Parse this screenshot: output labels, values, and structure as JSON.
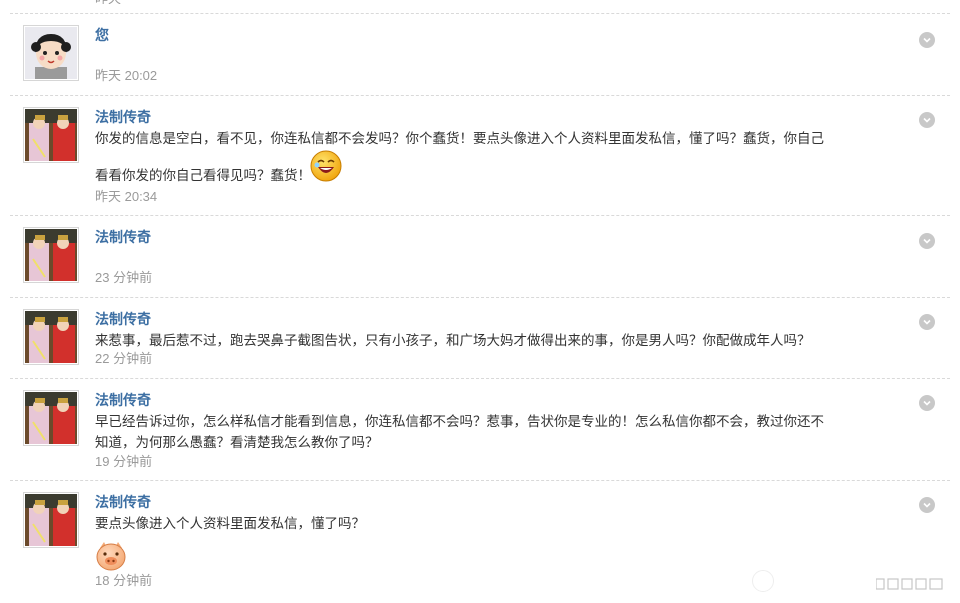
{
  "top_fragment": "昨天",
  "messages": [
    {
      "sender": "您",
      "text_lines": [],
      "time": "昨天 20:02",
      "avatar": "cartoon-girl-avatar"
    },
    {
      "sender": "法制传奇",
      "text_lines": [
        "你发的信息是空白，看不见，你连私信都不会发吗？你个蠢货！要点头像进入个人资料里面发私信，懂了吗？蠢货，你自己",
        "看看你发的你自己看得见吗？蠢货！"
      ],
      "emoji": "laughing-face-emoji",
      "time": "昨天 20:34",
      "avatar": "couple-photo-avatar"
    },
    {
      "sender": "法制传奇",
      "text_lines": [],
      "time": "23 分钟前",
      "avatar": "couple-photo-avatar"
    },
    {
      "sender": "法制传奇",
      "text_lines": [
        "来惹事，最后惹不过，跑去哭鼻子截图告状，只有小孩子，和广场大妈才做得出来的事，你是男人吗？你配做成年人吗？"
      ],
      "time": "22 分钟前",
      "avatar": "couple-photo-avatar"
    },
    {
      "sender": "法制传奇",
      "text_lines": [
        "早已经告诉过你，怎么样私信才能看到信息，你连私信都不会吗？惹事，告状你是专业的！怎么私信你都不会，教过你还不",
        "知道，为何那么愚蠢？看清楚我怎么教你了吗？"
      ],
      "time": "19 分钟前",
      "avatar": "couple-photo-avatar"
    },
    {
      "sender": "法制传奇",
      "text_lines": [
        "要点头像进入个人资料里面发私信，懂了吗？"
      ],
      "emoji": "pig-face-emoji",
      "time": "18 分钟前",
      "avatar": "couple-photo-avatar"
    }
  ],
  "colors": {
    "sender_name": "#3d6fa3",
    "timestamp": "#9a9a9a",
    "divider": "#d9d9d9",
    "menu_button": "#c8c8c8"
  }
}
